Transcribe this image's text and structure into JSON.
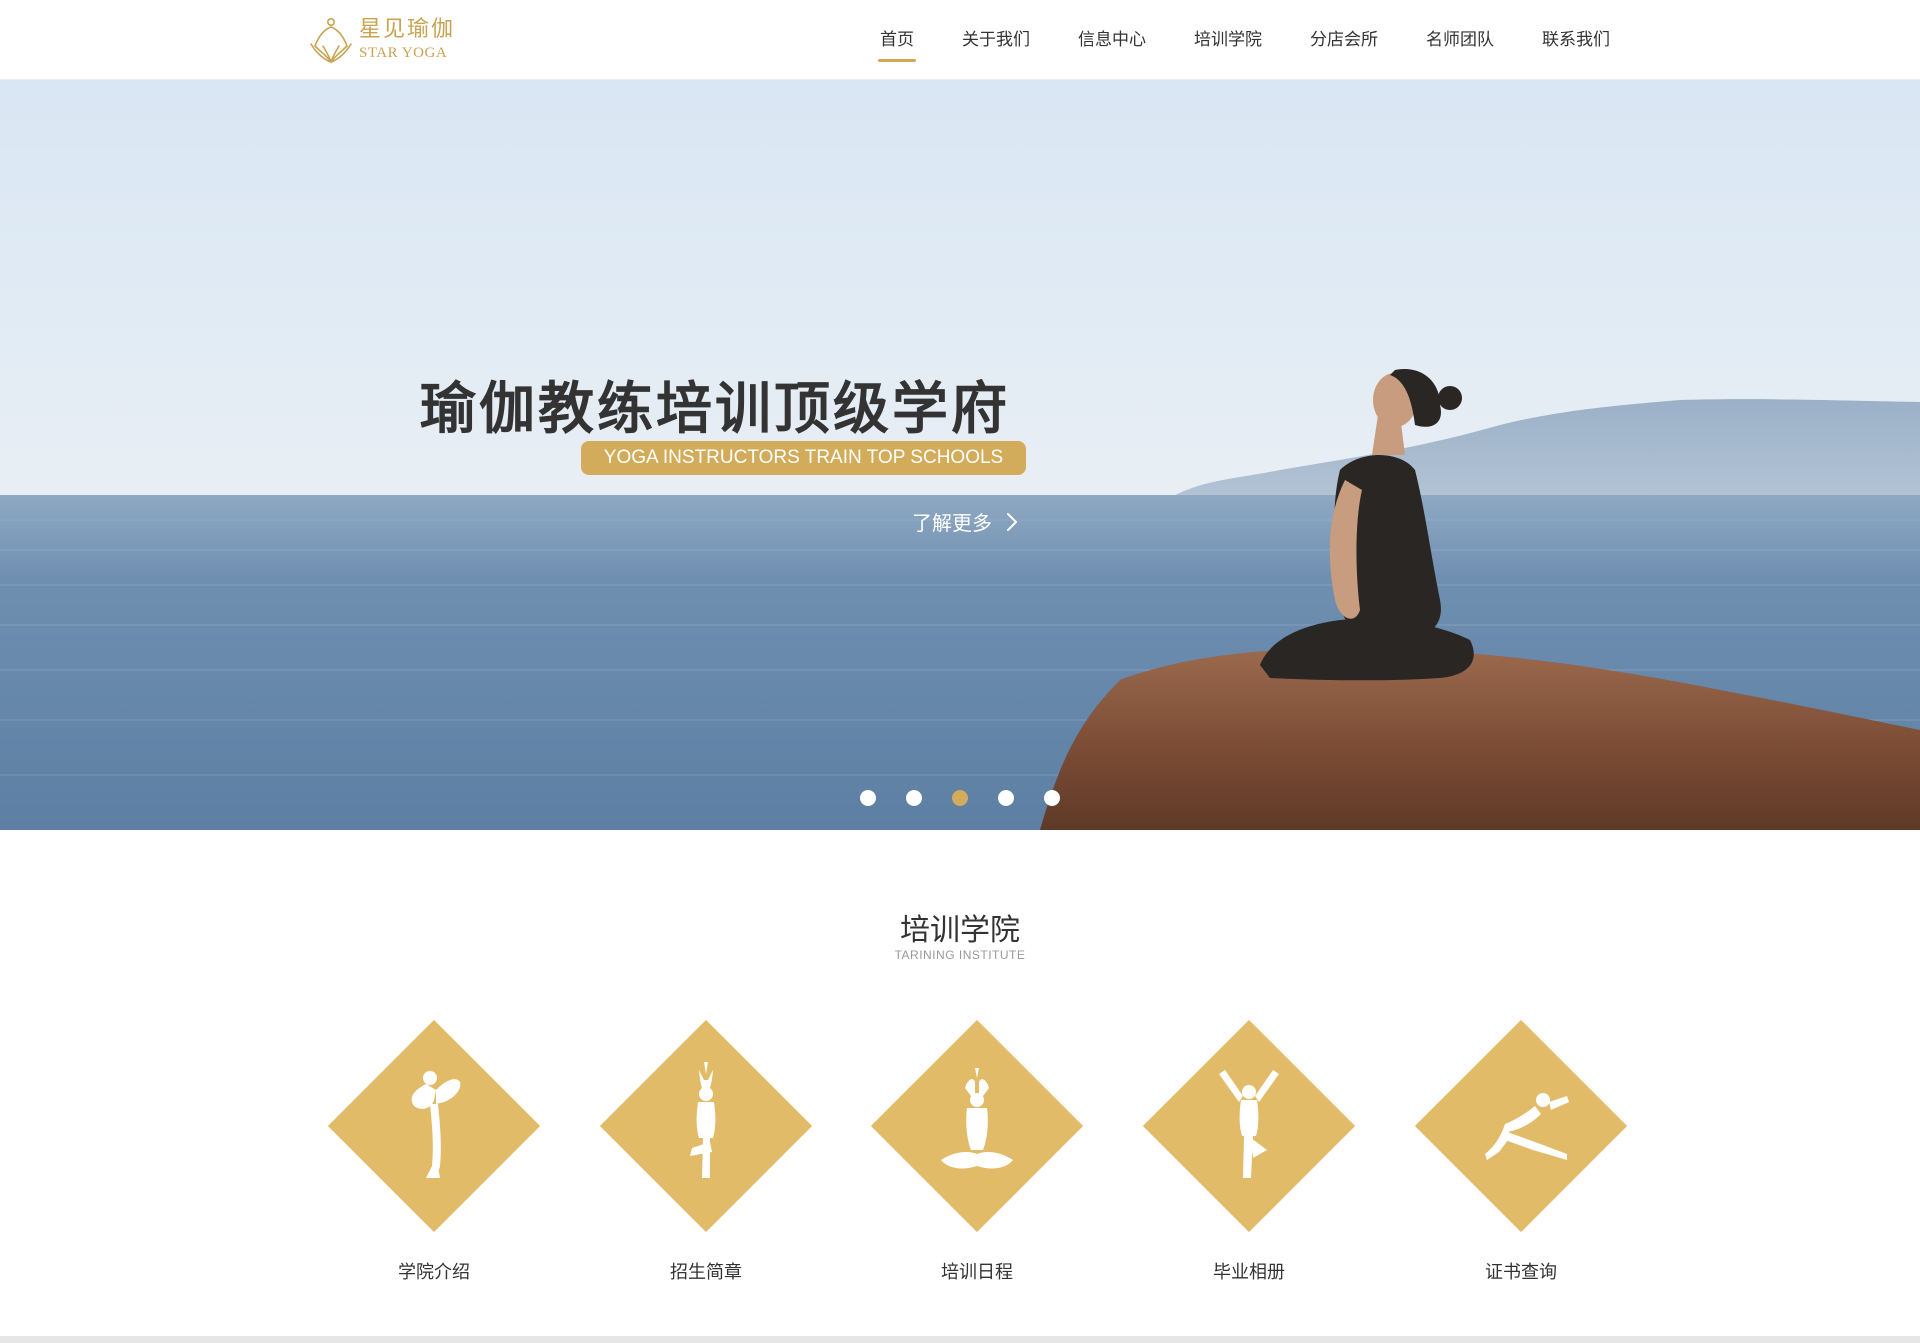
{
  "brand": {
    "name_cn": "星见瑜伽",
    "name_en": "STAR YOGA",
    "accent_color": "#d2ac5a"
  },
  "nav": {
    "items": [
      {
        "label": "首页",
        "active": true
      },
      {
        "label": "关于我们",
        "active": false
      },
      {
        "label": "信息中心",
        "active": false
      },
      {
        "label": "培训学院",
        "active": false
      },
      {
        "label": "分店会所",
        "active": false
      },
      {
        "label": "名师团队",
        "active": false
      },
      {
        "label": "联系我们",
        "active": false
      }
    ]
  },
  "banner": {
    "title": "瑜伽教练培训顶级学府",
    "subtitle": "YOGA INSTRUCTORS TRAIN TOP SCHOOLS",
    "more_label": "了解更多",
    "more_icon": "chevron-right-icon",
    "slides_total": 5,
    "active_slide": 3
  },
  "training": {
    "title": "培训学院",
    "subtitle": "TARINING INSTITUTE",
    "items": [
      {
        "label": "学院介绍",
        "icon": "dancer-pose-icon"
      },
      {
        "label": "招生简章",
        "icon": "tree-pose-icon"
      },
      {
        "label": "培训日程",
        "icon": "lotus-pose-icon"
      },
      {
        "label": "毕业相册",
        "icon": "raised-arms-pose-icon"
      },
      {
        "label": "证书查询",
        "icon": "lunge-stretch-pose-icon"
      }
    ]
  }
}
